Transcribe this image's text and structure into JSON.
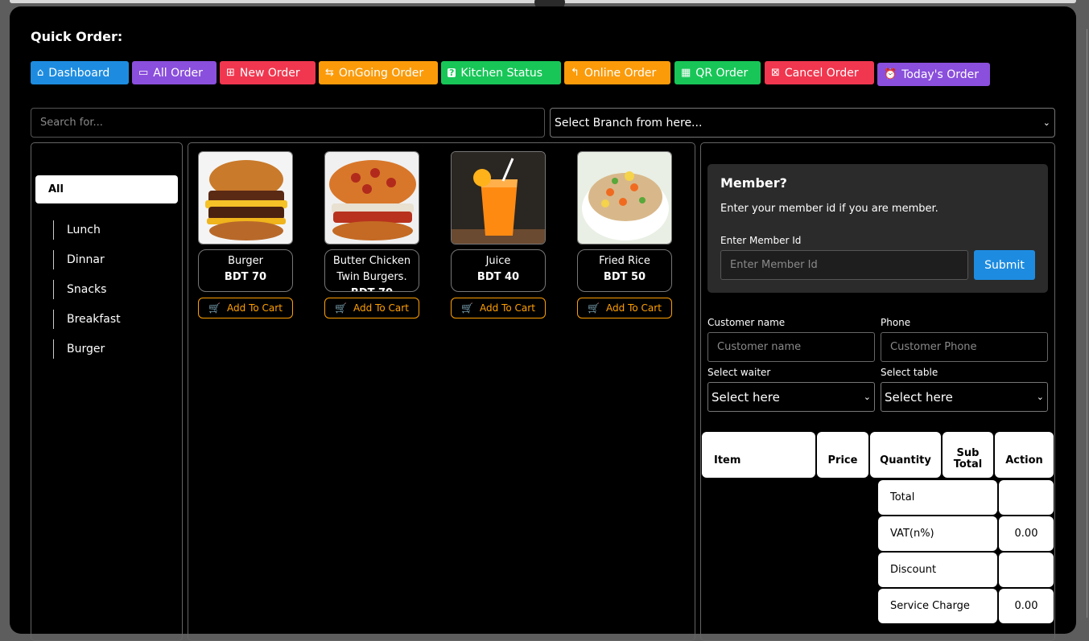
{
  "page": {
    "title": "Quick Order:"
  },
  "nav": [
    {
      "label": "Dashboard",
      "icon": "home-icon",
      "glyph": "⌂",
      "color": "#1d8ce0"
    },
    {
      "label": "All Order",
      "icon": "list-icon",
      "glyph": "▭",
      "color": "#8a4fdc"
    },
    {
      "label": "New Order",
      "icon": "plus-square-icon",
      "glyph": "⊞",
      "color": "#f0374f"
    },
    {
      "label": "OnGoing Order",
      "icon": "exchange-icon",
      "glyph": "⇆",
      "color": "#fb9b0a"
    },
    {
      "label": "Kitchen Status",
      "icon": "question-icon",
      "glyph": "?",
      "color": "#18c658"
    },
    {
      "label": "Online Order",
      "icon": "upload-icon",
      "glyph": "⮤",
      "color": "#fb9b0a"
    },
    {
      "label": "QR Order",
      "icon": "qr-icon",
      "glyph": "▦",
      "color": "#18c658"
    },
    {
      "label": "Cancel Order",
      "icon": "close-square-icon",
      "glyph": "⊠",
      "color": "#f0374f"
    },
    {
      "label": "Today's Order",
      "icon": "alarm-icon",
      "glyph": "⏰",
      "color": "#8a4fdc"
    }
  ],
  "search": {
    "placeholder": "Search for..."
  },
  "branch": {
    "selected": "Select Branch from here..."
  },
  "categories": {
    "all": "All",
    "items": [
      "Lunch",
      "Dinnar",
      "Snacks",
      "Breakfast",
      "Burger"
    ]
  },
  "products": [
    {
      "name": "Burger",
      "price": "BDT 70",
      "button": "Add To Cart"
    },
    {
      "name": "Butter Chicken Twin Burgers.",
      "price": "BDT 70",
      "button": "Add To Cart"
    },
    {
      "name": "Juice",
      "price": "BDT 40",
      "button": "Add To Cart"
    },
    {
      "name": "Fried Rice",
      "price": "BDT 50",
      "button": "Add To Cart"
    }
  ],
  "member": {
    "title": "Member?",
    "subtitle": "Enter your member id if you are member.",
    "label": "Enter Member Id",
    "placeholder": "Enter Member Id",
    "submit": "Submit"
  },
  "form": {
    "customer_name_label": "Customer name",
    "customer_name_placeholder": "Customer name",
    "phone_label": "Phone",
    "phone_placeholder": "Customer Phone",
    "waiter_label": "Select waiter",
    "waiter_selected": "Select here",
    "table_label": "Select table",
    "table_selected": "Select here"
  },
  "table": {
    "headers": [
      "Item",
      "Price",
      "Quantity",
      "Sub Total",
      "Action"
    ],
    "summary": [
      {
        "label": "Total",
        "value": ""
      },
      {
        "label": "VAT(n%)",
        "value": "0.00"
      },
      {
        "label": "Discount",
        "value": ""
      },
      {
        "label": "Service Charge",
        "value": "0.00"
      }
    ]
  }
}
